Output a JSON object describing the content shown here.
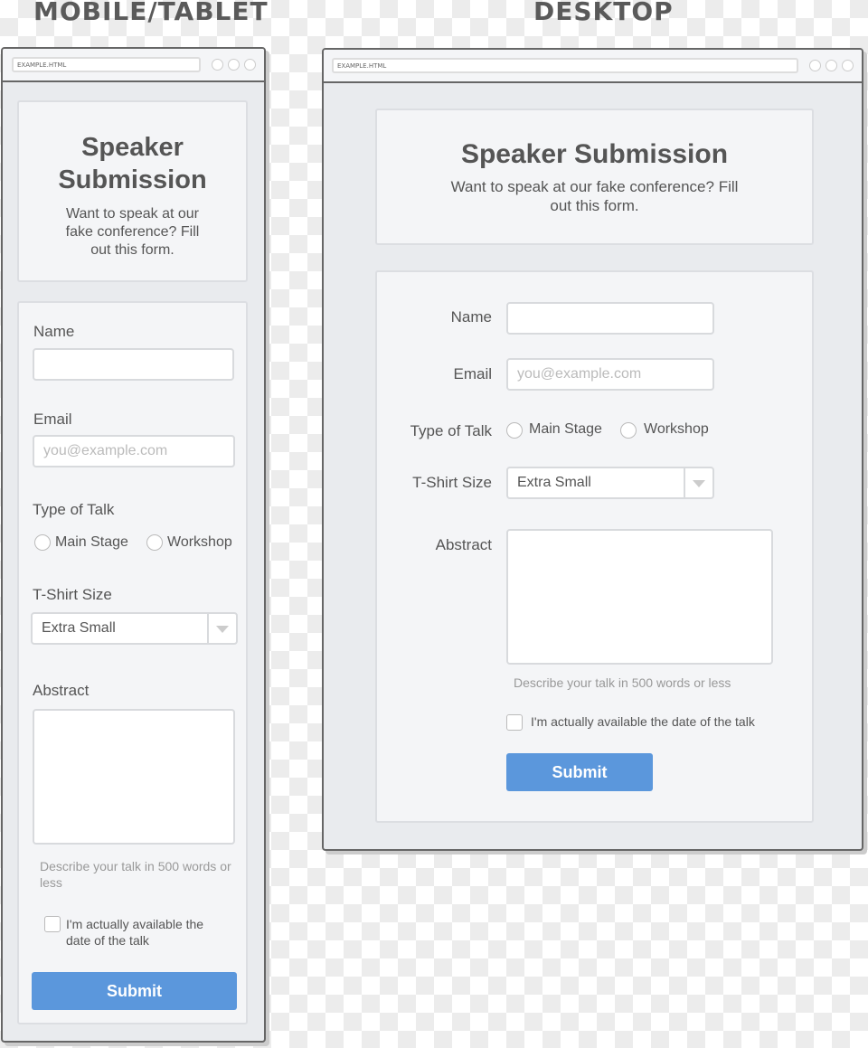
{
  "headings": {
    "mobile": "MOBILE/TABLET",
    "desktop": "DESKTOP"
  },
  "browser": {
    "url": "EXAMPLE.HTML"
  },
  "form": {
    "title": "Speaker Submission",
    "title_mobile_1": "Speaker",
    "title_mobile_2": "Submission",
    "subtitle": "Want to speak at our fake conference? Fill out this form.",
    "name_label": "Name",
    "name_value": "",
    "email_label": "Email",
    "email_placeholder": "you@example.com",
    "talk_label": "Type of Talk",
    "talk_options": [
      "Main Stage",
      "Workshop"
    ],
    "shirt_label": "T-Shirt Size",
    "shirt_value": "Extra Small",
    "abstract_label": "Abstract",
    "abstract_help": "Describe your talk in 500 words or less",
    "available_label": "I'm actually available the date of the talk",
    "submit_label": "Submit"
  },
  "colors": {
    "accent": "#5b97dc",
    "panel": "#e9ebee",
    "card": "#f4f5f7"
  }
}
